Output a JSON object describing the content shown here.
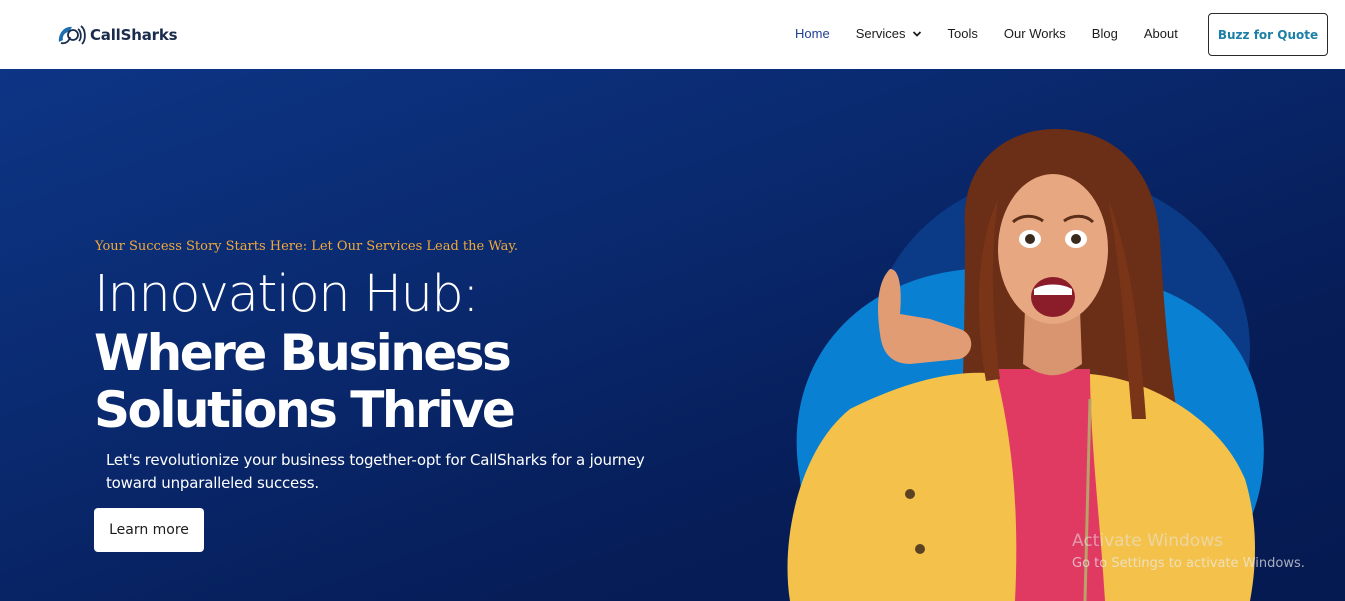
{
  "header": {
    "logo_text": "CallSharks",
    "nav": [
      {
        "label": "Home",
        "active": true
      },
      {
        "label": "Services",
        "has_dropdown": true
      },
      {
        "label": "Tools"
      },
      {
        "label": "Our Works"
      },
      {
        "label": "Blog"
      },
      {
        "label": "About"
      }
    ],
    "cta_label": "Buzz for Quote"
  },
  "hero": {
    "tagline": "Your Success Story Starts Here: Let Our Services Lead the Way.",
    "headline_light": "Innovation Hub:",
    "headline_bold_1": "Where Business",
    "headline_bold_2": "Solutions Thrive",
    "description": "Let's revolutionize your business together-opt for CallSharks for a journey toward unparalleled success.",
    "button_label": "Learn more"
  },
  "watermark": {
    "title": "Activate Windows",
    "subtitle": "Go to Settings to activate Windows."
  },
  "colors": {
    "hero_bg": "#0a2a70",
    "accent_orange": "#f2a93b",
    "nav_active": "#1f3f96",
    "cta_text": "#1c7fa6",
    "blob_blue": "#0a7fd1",
    "jacket_yellow": "#f4c24a"
  }
}
